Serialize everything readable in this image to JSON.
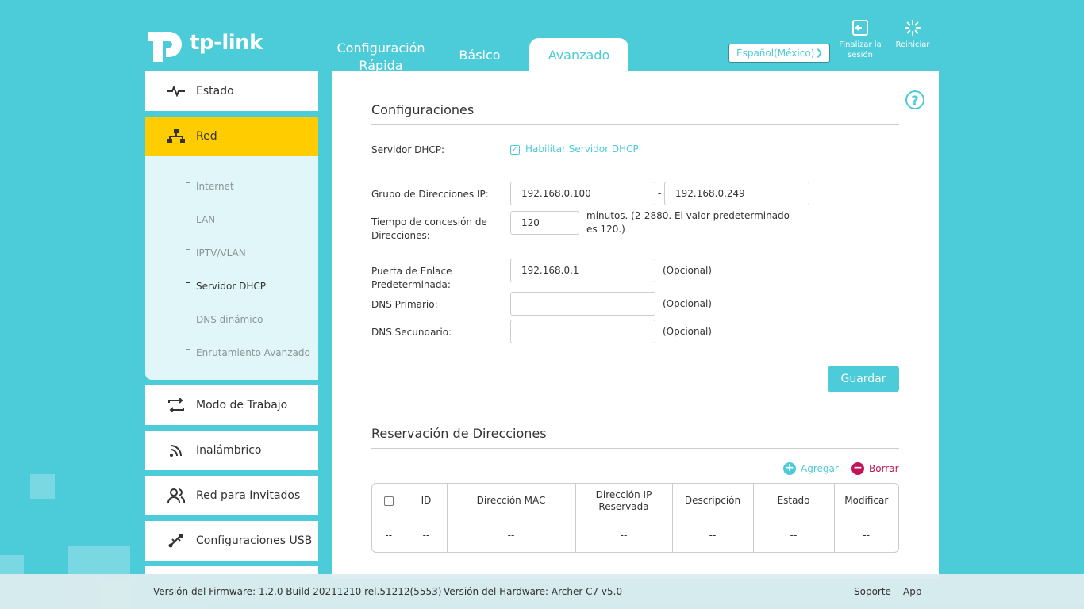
{
  "brand": {
    "name": "tp-link"
  },
  "tabs": [
    {
      "label": "Configuración Rápida"
    },
    {
      "label": "Básico"
    },
    {
      "label": "Avanzado"
    }
  ],
  "header": {
    "language": "Español(México)",
    "logout_label": "Finalizar la sesión",
    "reboot_label": "Reiniciar",
    "accent_color": "#4ccbd8"
  },
  "sidebar": {
    "items": [
      {
        "label": "Estado",
        "icon": "pulse-icon"
      },
      {
        "label": "Red",
        "icon": "network-icon",
        "active": true
      },
      {
        "label": "Modo de Trabajo",
        "icon": "switch-mode-icon"
      },
      {
        "label": "Inalámbrico",
        "icon": "wireless-icon"
      },
      {
        "label": "Red para Invitados",
        "icon": "guests-icon"
      },
      {
        "label": "Configuraciones USB",
        "icon": "usb-icon"
      }
    ],
    "submenu": [
      {
        "label": "Internet"
      },
      {
        "label": "LAN"
      },
      {
        "label": "IPTV/VLAN"
      },
      {
        "label": "Servidor DHCP",
        "active": true
      },
      {
        "label": "DNS dinámico"
      },
      {
        "label": "Enrutamiento Avanzado"
      }
    ]
  },
  "settings": {
    "title": "Configuraciones",
    "dhcp_label": "Servidor DHCP:",
    "dhcp_enable_label": "Habilitar Servidor DHCP",
    "dhcp_enabled": true,
    "ip_pool_label": "Grupo de Direcciones IP:",
    "ip_start": "192.168.0.100",
    "ip_separator": "-",
    "ip_end": "192.168.0.249",
    "lease_label": "Tiempo de concesión de Direcciones:",
    "lease_value": "120",
    "lease_note": "minutos. (2-2880. El valor predeterminado es 120.)",
    "gateway_label": "Puerta de Enlace Predeterminada:",
    "gateway_value": "192.168.0.1",
    "dns1_label": "DNS Primario:",
    "dns1_value": "",
    "dns2_label": "DNS Secundario:",
    "dns2_value": "",
    "optional": "(Opcional)",
    "save_label": "Guardar"
  },
  "reservation": {
    "title": "Reservación de Direcciones",
    "add_label": "Agregar",
    "delete_label": "Borrar",
    "columns": [
      "ID",
      "Dirección MAC",
      "Dirección IP Reservada",
      "Descripción",
      "Estado",
      "Modificar"
    ],
    "rows": [
      [
        "--",
        "--",
        "--",
        "--",
        "--",
        "--",
        "--"
      ]
    ]
  },
  "footer": {
    "firmware": "Versión del Firmware: 1.2.0 Build 20211210 rel.51212(5553)",
    "hardware": "Versión del Hardware: Archer C7 v5.0",
    "support": "Soporte",
    "app": "App"
  }
}
